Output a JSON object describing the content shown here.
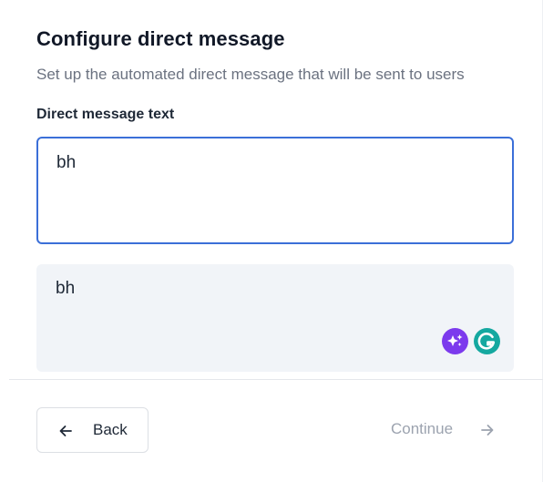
{
  "header": {
    "title": "Configure direct message",
    "subtitle": "Set up the automated direct message that will be sent to users"
  },
  "message_field": {
    "label": "Direct message text",
    "value": "bh"
  },
  "preview": {
    "text": "bh"
  },
  "extensions": {
    "icons": [
      "sparkle-icon",
      "grammarly-icon"
    ],
    "colors": {
      "sparkle": "#7c3aed",
      "grammarly": "#15a8a0"
    }
  },
  "footer": {
    "back_label": "Back",
    "back_icon": "arrow-left-icon",
    "continue_label": "Continue",
    "continue_icon": "arrow-right-icon"
  },
  "colors": {
    "focus_border": "#3b6fd8",
    "preview_background": "#f1f4f8",
    "muted_text": "#9ca3af"
  }
}
